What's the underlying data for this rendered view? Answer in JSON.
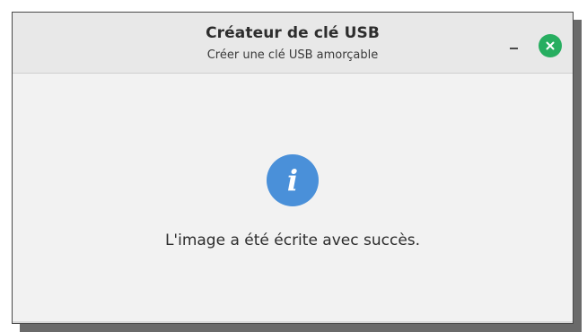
{
  "window": {
    "title": "Créateur de clé USB",
    "subtitle": "Créer une clé USB amorçable"
  },
  "titlebar": {
    "minimize_icon": "minimize-icon",
    "close_icon": "close-icon",
    "close_color": "#27ae60"
  },
  "dialog": {
    "icon": "info-icon",
    "icon_glyph": "i",
    "icon_color": "#4a90d9",
    "message": "L'image a été écrite avec succès."
  }
}
